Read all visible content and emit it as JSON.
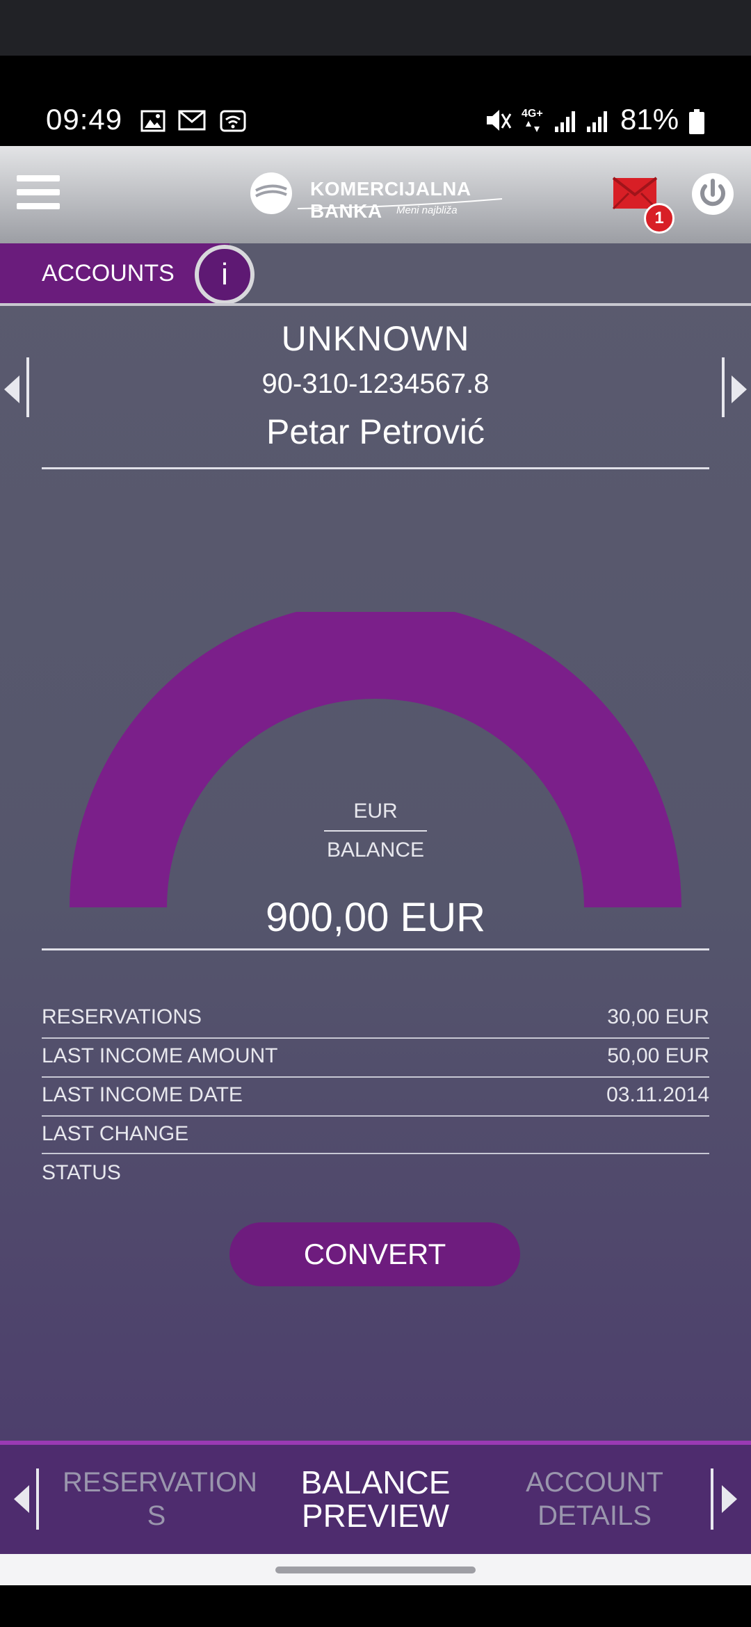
{
  "status_bar": {
    "time": "09:49",
    "battery": "81%",
    "icons": [
      "gallery-icon",
      "mail-icon",
      "wifi-icon",
      "mute-icon",
      "4g-icon",
      "signal-icon",
      "signal-icon",
      "battery-icon"
    ]
  },
  "header": {
    "logo_name": "KOMERCIJALNA BANKA",
    "logo_tagline": "Meni najbliža",
    "mail_badge": "1",
    "icons": [
      "menu-icon",
      "logo",
      "mail-icon",
      "power-icon"
    ]
  },
  "accounts": {
    "label": "ACCOUNTS",
    "info_glyph": "i"
  },
  "account": {
    "type": "UNKNOWN",
    "number": "90-310-1234567.8",
    "owner": "Petar Petrović"
  },
  "balance": {
    "currency": "EUR",
    "label": "BALANCE",
    "value": "900,00 EUR",
    "gauge_fill": 1.0
  },
  "details": [
    {
      "key": "RESERVATIONS",
      "value": "30,00 EUR"
    },
    {
      "key": "LAST INCOME AMOUNT",
      "value": "50,00 EUR"
    },
    {
      "key": "LAST INCOME DATE",
      "value": "03.11.2014"
    },
    {
      "key": "LAST CHANGE",
      "value": ""
    },
    {
      "key": "STATUS",
      "value": ""
    }
  ],
  "convert_label": "CONVERT",
  "tabs": {
    "left": {
      "line1": "RESERVATION",
      "line2": "S"
    },
    "center": {
      "line1": "BALANCE",
      "line2": "PREVIEW"
    },
    "right": {
      "line1": "ACCOUNT",
      "line2": "DETAILS"
    }
  },
  "colors": {
    "accent": "#7b1f8a",
    "tab_active": "#ffffff",
    "tab_inactive": "#9a96ad",
    "badge": "#d81f26"
  }
}
